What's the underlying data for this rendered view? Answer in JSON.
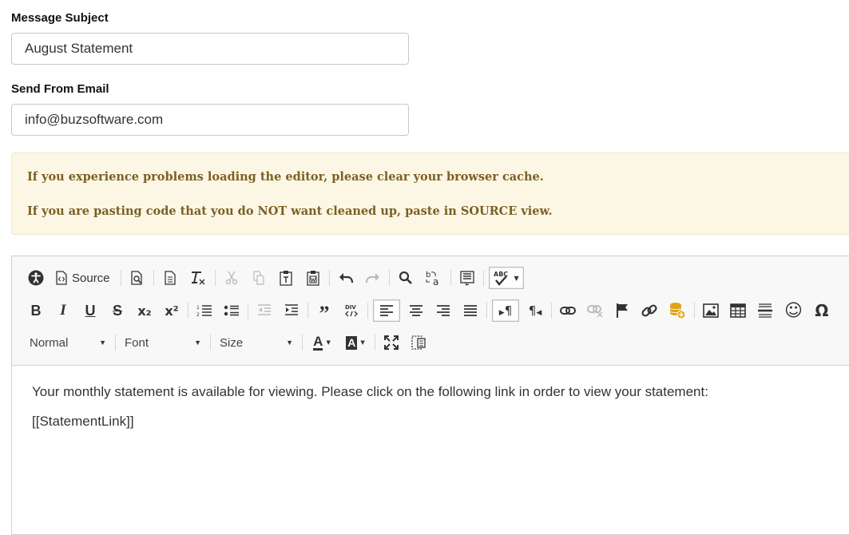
{
  "form": {
    "subject_label": "Message Subject",
    "subject_value": "August Statement",
    "from_label": "Send From Email",
    "from_value": "info@buzsoftware.com"
  },
  "notice": {
    "line1": "If you experience problems loading the editor, please clear your browser cache.",
    "line2": "If you are pasting code that you do NOT want cleaned up, paste in SOURCE view."
  },
  "toolbar": {
    "source_label": "Source",
    "format_value": "Normal",
    "font_value": "Font",
    "size_value": "Size",
    "bold": "B",
    "italic": "I",
    "underline": "U",
    "strike": "S",
    "subscript": "x₂",
    "superscript": "x²",
    "blockquote": "”",
    "text_color": "A",
    "bg_color": "A",
    "special_char": "Ω",
    "smiley": "☺",
    "pilcrow_ltr": "¶",
    "pilcrow_rtl": "¶",
    "abc": "ABC"
  },
  "editor": {
    "line1": "Your monthly statement is available for viewing. Please click on the following link in order to view your statement:",
    "line2": "[[StatementLink]]"
  },
  "colors": {
    "notice_bg": "#fcf7e4",
    "notice_text": "#7b5f24",
    "placeholder_icon": "#e3a21a"
  }
}
